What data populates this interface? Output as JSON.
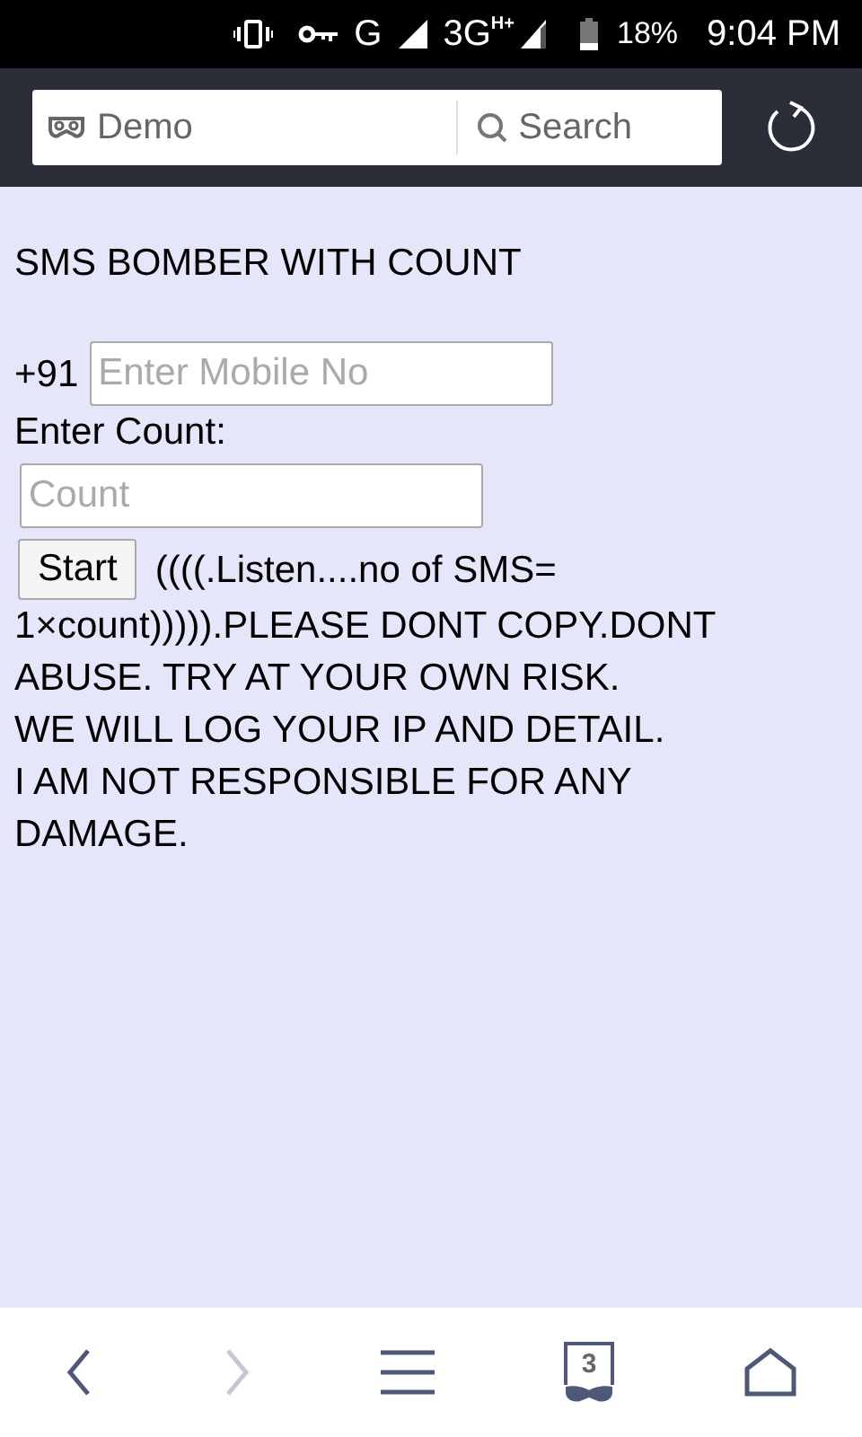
{
  "status_bar": {
    "network_1": "G",
    "network_2": "3G",
    "network_2_badge": "H+",
    "battery": "18%",
    "time": "9:04 PM"
  },
  "browser_toolbar": {
    "tab_name": "Demo",
    "search_placeholder": "Search"
  },
  "page": {
    "title": "SMS BOMBER WITH COUNT",
    "country_code": "+91",
    "mobile_placeholder": "Enter Mobile No",
    "count_label": "Enter Count:",
    "count_placeholder": "Count",
    "start_button": "Start",
    "notice_lines": [
      "((((.Listen....no of SMS=",
      "1×count))))).PLEASE DONT COPY.DONT",
      "ABUSE. TRY AT YOUR OWN RISK.",
      "WE WILL LOG YOUR IP AND DETAIL.",
      "I AM NOT RESPONSIBLE FOR ANY",
      "DAMAGE."
    ]
  },
  "bottom_bar": {
    "back_disabled": false,
    "forward_disabled": true,
    "tab_count": "3"
  }
}
